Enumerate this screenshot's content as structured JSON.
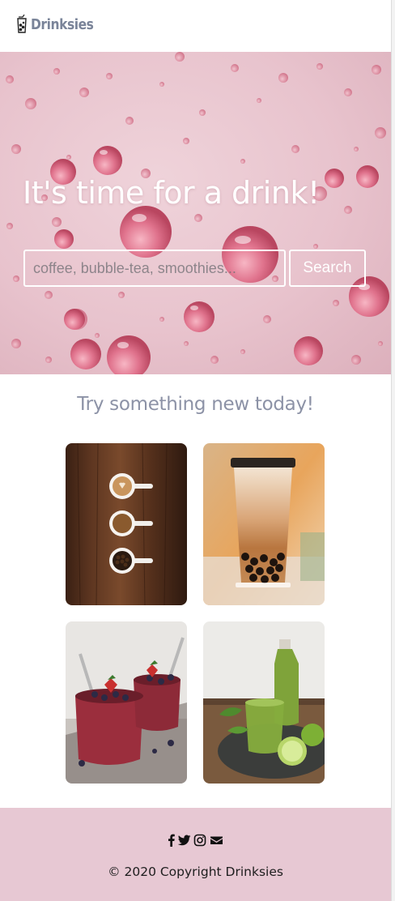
{
  "header": {
    "brand_name": "Drinksies",
    "brand_icon": "drink-cup-icon",
    "brand_color": "#7a8499"
  },
  "hero": {
    "title": "It's time for a drink!",
    "search": {
      "placeholder": "coffee, bubble-tea, smoothies...",
      "value": "",
      "button_label": "Search"
    },
    "background_color": "#e8c3cd"
  },
  "featured": {
    "title": "Try something new today!",
    "title_color": "#8c92a6",
    "tiles": [
      {
        "icon": "coffee-cups-image"
      },
      {
        "icon": "bubble-tea-image"
      },
      {
        "icon": "berry-smoothie-image"
      },
      {
        "icon": "green-smoothie-image"
      }
    ]
  },
  "footer": {
    "social_icons": [
      "facebook-icon",
      "twitter-icon",
      "instagram-icon",
      "envelope-icon"
    ],
    "copyright": "© 2020 Copyright Drinksies",
    "background_color": "#e7c8d3"
  }
}
